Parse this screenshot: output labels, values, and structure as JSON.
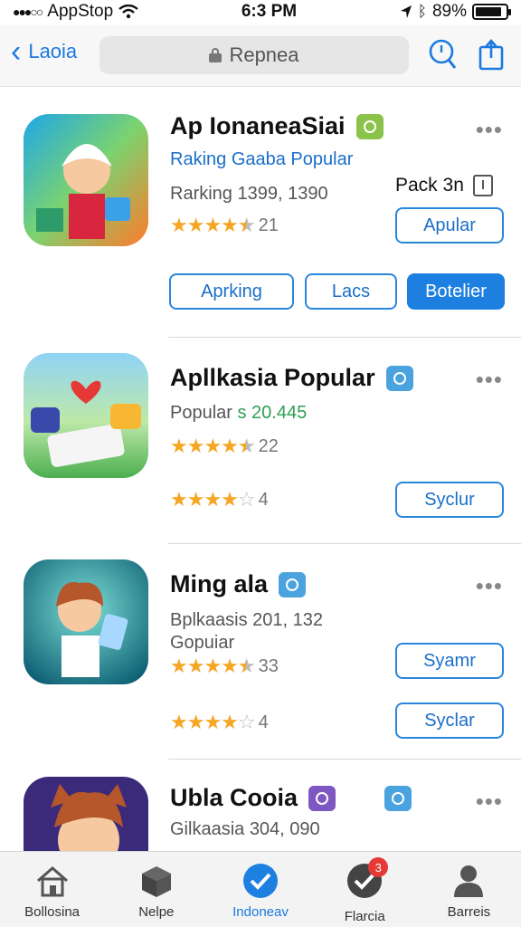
{
  "status_bar": {
    "carrier": "AppStop",
    "time": "6:3 PM",
    "battery_text": "89%",
    "battery_level": 0.89
  },
  "nav": {
    "back_label": "Laoia",
    "search_text": "Repnea"
  },
  "apps": [
    {
      "title": "Ap IonaneaSiai",
      "badge_color": "#8bc34a",
      "subtitle_link": "Raking Gaaba Popular",
      "info": "Rarking 1399, 1390",
      "stars": 4.5,
      "rating_count": "21",
      "pack_label": "Pack 3n",
      "get_button": "Apular",
      "actions": [
        "Aprking",
        "Lacs",
        "Botelier"
      ]
    },
    {
      "title": "Apllkasia Popular",
      "badge_color": "#4aa3df",
      "info_prefix": "Popular",
      "info_value": "s 20.445",
      "stars": 4.5,
      "rating_count": "22",
      "stars2": 4,
      "rating_count2": "4",
      "get_button": "Syclur"
    },
    {
      "title": "Ming ala",
      "badge_color": "#4aa3df",
      "info": "Bplkaasis 201, 132",
      "info2": "Gopuiar",
      "stars": 4.5,
      "rating_count": "33",
      "stars2": 4,
      "rating_count2": "4",
      "get_button": "Syamr",
      "get_button2": "Syclar"
    },
    {
      "title": "Ubla Cooia",
      "badge_color": "#7e57c2",
      "badge2_color": "#4aa3df",
      "info": "Gilkaasia 304, 090"
    }
  ],
  "tabs": [
    {
      "label": "Bollosina",
      "icon": "house-icon"
    },
    {
      "label": "Nelpe",
      "icon": "box-icon"
    },
    {
      "label": "Indoneav",
      "icon": "check-circle-icon"
    },
    {
      "label": "Flarcia",
      "icon": "check-badge-icon",
      "badge": "3"
    },
    {
      "label": "Barreis",
      "icon": "person-icon"
    }
  ],
  "colors": {
    "accent": "#1a7ae0",
    "star": "#f5a623",
    "price_green": "#2e9e55"
  }
}
